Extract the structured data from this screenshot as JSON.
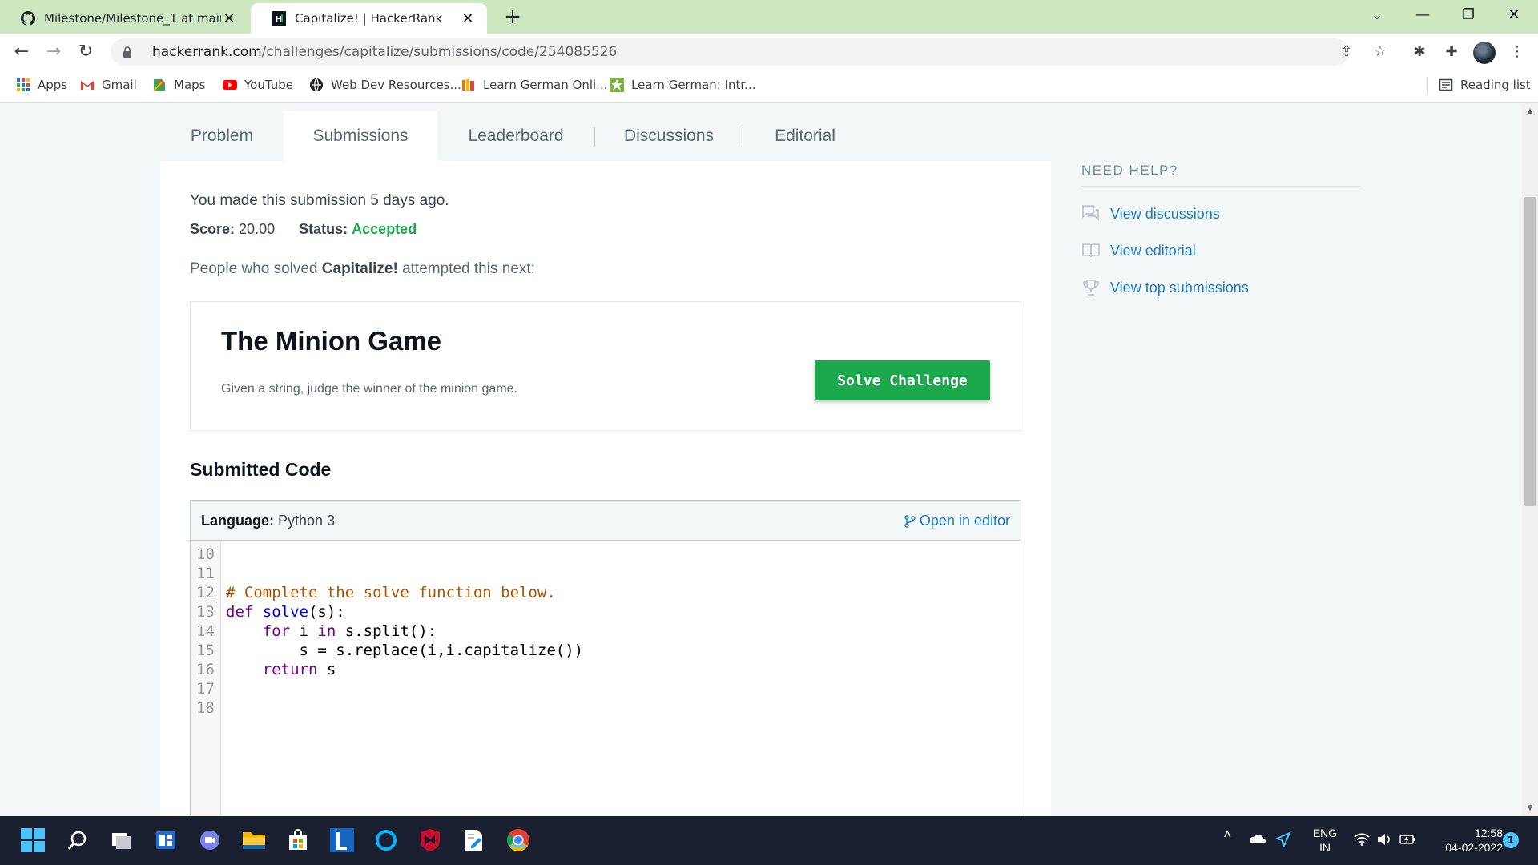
{
  "browser": {
    "tabs": [
      {
        "label": "Milestone/Milestone_1 at main ·",
        "icon": "github-icon"
      },
      {
        "label": "Capitalize! | HackerRank",
        "icon": "hackerrank-icon",
        "active": true
      }
    ],
    "url_host": "hackerrank.com",
    "url_path": "/challenges/capitalize/submissions/code/254085526",
    "bookmarks": [
      "Apps",
      "Gmail",
      "Maps",
      "YouTube",
      "Web Dev Resources...",
      "Learn German Onli...",
      "Learn German: Intr..."
    ],
    "reading_list": "Reading list"
  },
  "nav_tabs": [
    "Problem",
    "Submissions",
    "Leaderboard",
    "Discussions",
    "Editorial"
  ],
  "submission": {
    "made": "You made this submission 5 days ago.",
    "score_label": "Score:",
    "score_value": "20.00",
    "status_label": "Status:",
    "status_value": "Accepted",
    "people_prefix": "People who solved ",
    "people_challenge": "Capitalize!",
    "people_suffix": " attempted this next:"
  },
  "next_challenge": {
    "title": "The Minion Game",
    "description": "Given a string, judge the winner of the minion game.",
    "button": "Solve Challenge"
  },
  "submitted_code": {
    "title": "Submitted Code",
    "language_label": "Language:",
    "language_value": "Python 3",
    "open_editor": "Open in editor",
    "line_numbers": [
      "10",
      "11",
      "12",
      "13",
      "14",
      "15",
      "16",
      "17",
      "18"
    ]
  },
  "help": {
    "title": "NEED HELP?",
    "links": [
      "View discussions",
      "View editorial",
      "View top submissions"
    ]
  },
  "taskbar": {
    "lang_top": "ENG",
    "lang_bottom": "IN",
    "time": "12:58",
    "date": "04-02-2022",
    "notifications": "1"
  },
  "colors": {
    "tabbar": "#cde8c0",
    "accent_green": "#1ba94c",
    "link_blue": "#1f7ac2",
    "taskbar": "#1a2030"
  }
}
